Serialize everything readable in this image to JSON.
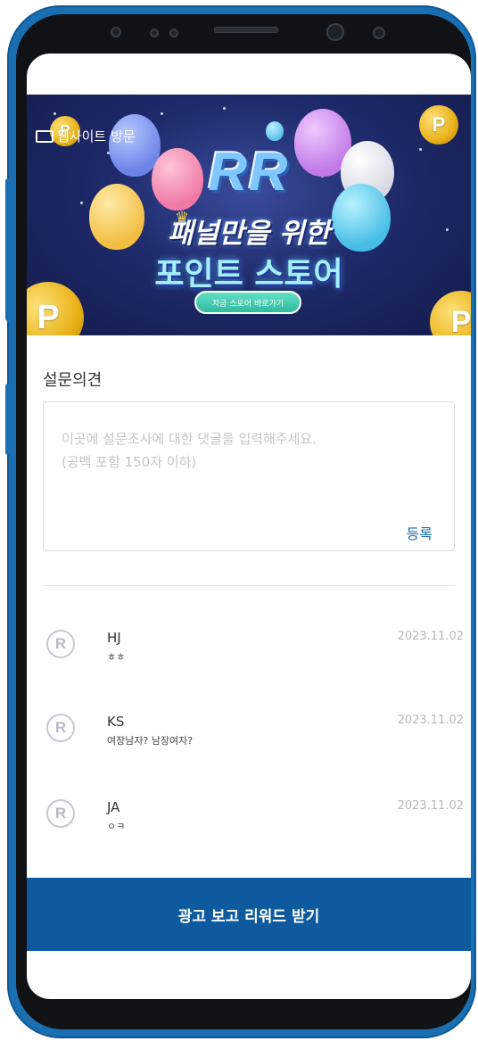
{
  "banner": {
    "visit_label": "웹사이트 방문",
    "logo_text": "RR",
    "headline_line1": "패널만을 위한",
    "headline_line2": "포인트 스토어",
    "store_button": "지금 스토어 바로가기",
    "coin_glyph": "P"
  },
  "survey": {
    "title": "설문의견",
    "placeholder": "이곳에 설문조사에 대한 댓글을 입력해주세요.\n(공백 포함 150자 이하)",
    "register_label": "등록"
  },
  "comments": [
    {
      "avatar": "R",
      "name": "HJ",
      "text": "ㅎㅎ",
      "date": "2023.11.02"
    },
    {
      "avatar": "R",
      "name": "KS",
      "text": "여장남자? 남장여자?",
      "date": "2023.11.02"
    },
    {
      "avatar": "R",
      "name": "JA",
      "text": "ㅇㅋ",
      "date": "2023.11.02"
    }
  ],
  "cta": {
    "label": "광고 보고 리워드 받기"
  },
  "colors": {
    "phone_frame": "#1a6fb3",
    "accent": "#0e5a9e",
    "register": "#1c6fb0"
  }
}
